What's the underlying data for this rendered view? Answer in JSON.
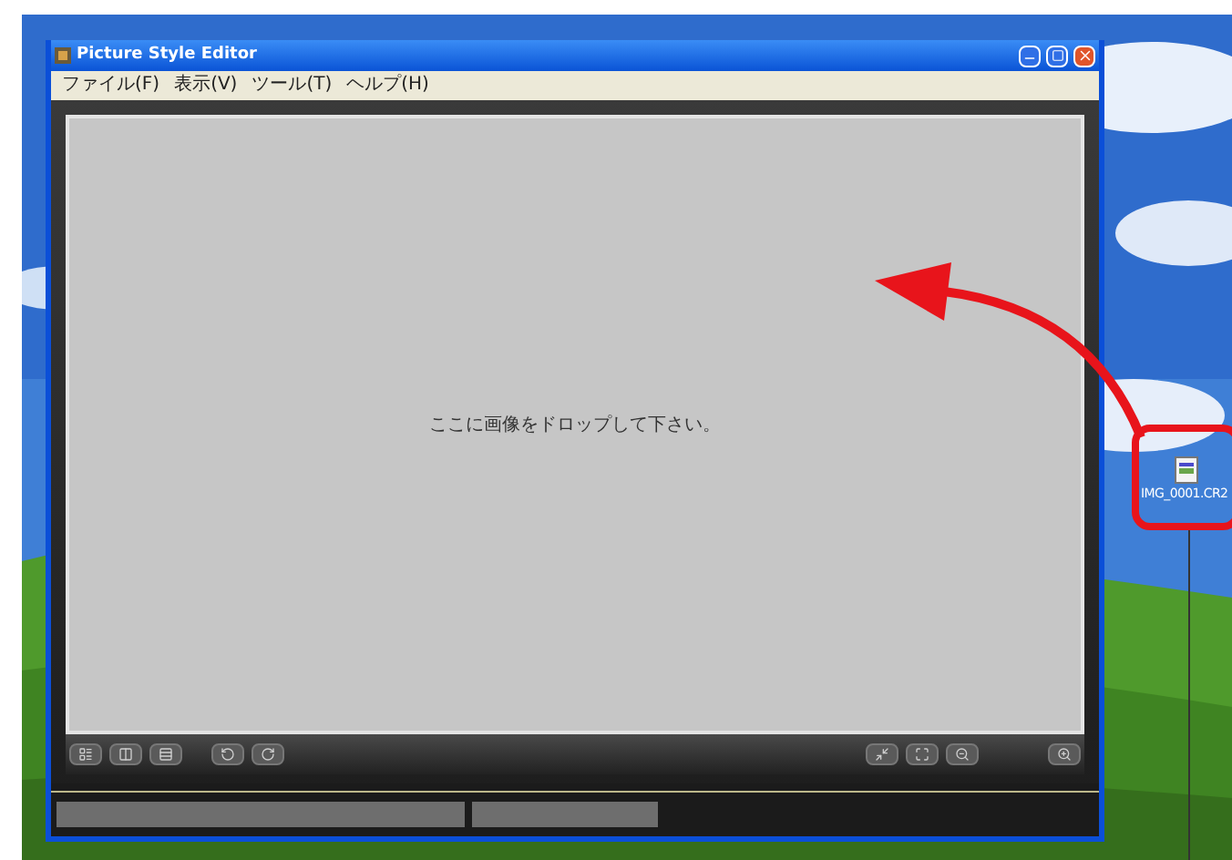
{
  "window": {
    "title": "Picture Style Editor"
  },
  "menu": [
    {
      "label": "ファイル(F)"
    },
    {
      "label": "表示(V)"
    },
    {
      "label": "ツール(T)"
    },
    {
      "label": "ヘルプ(H)"
    }
  ],
  "canvas": {
    "message": "ここに画像をドロップして下さい。"
  },
  "desktop_icon": {
    "label": "IMG_0001.CR2"
  }
}
